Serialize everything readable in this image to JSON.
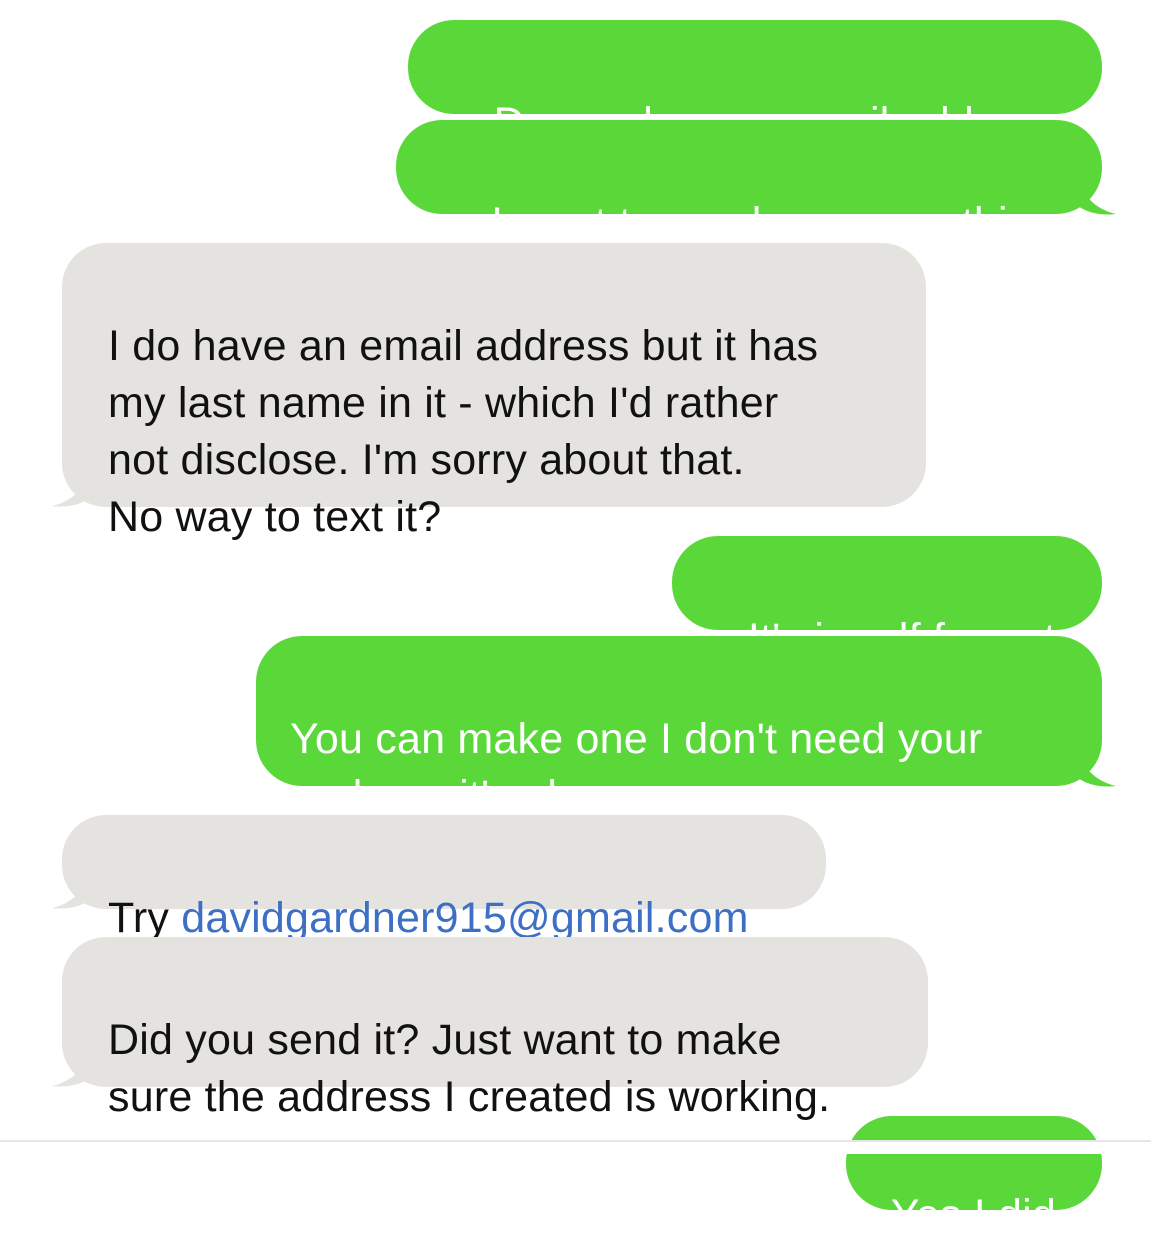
{
  "colors": {
    "sent_bubble": "#5ad83a",
    "received_bubble": "#e5e3df",
    "link": "#3d6fc4"
  },
  "messages": [
    {
      "side": "sent",
      "text": "Do you have a email address"
    },
    {
      "side": "sent",
      "text": "I want to send you something"
    },
    {
      "side": "received",
      "text": "I do have an email address but it has\nmy last name in it - which I'd rather\nnot disclose.  I'm sorry about that.\nNo way to text it?"
    },
    {
      "side": "sent",
      "text": "It's in pdf format"
    },
    {
      "side": "sent",
      "text": "You can make one I don't need your\nreal one it's ok"
    },
    {
      "side": "received",
      "prefix": "Try ",
      "link": "davidgardner915@gmail.com"
    },
    {
      "side": "received",
      "text": "Did you send it?  Just want to make\nsure the address I created is working."
    },
    {
      "side": "sent",
      "text": "Yes I did"
    }
  ]
}
